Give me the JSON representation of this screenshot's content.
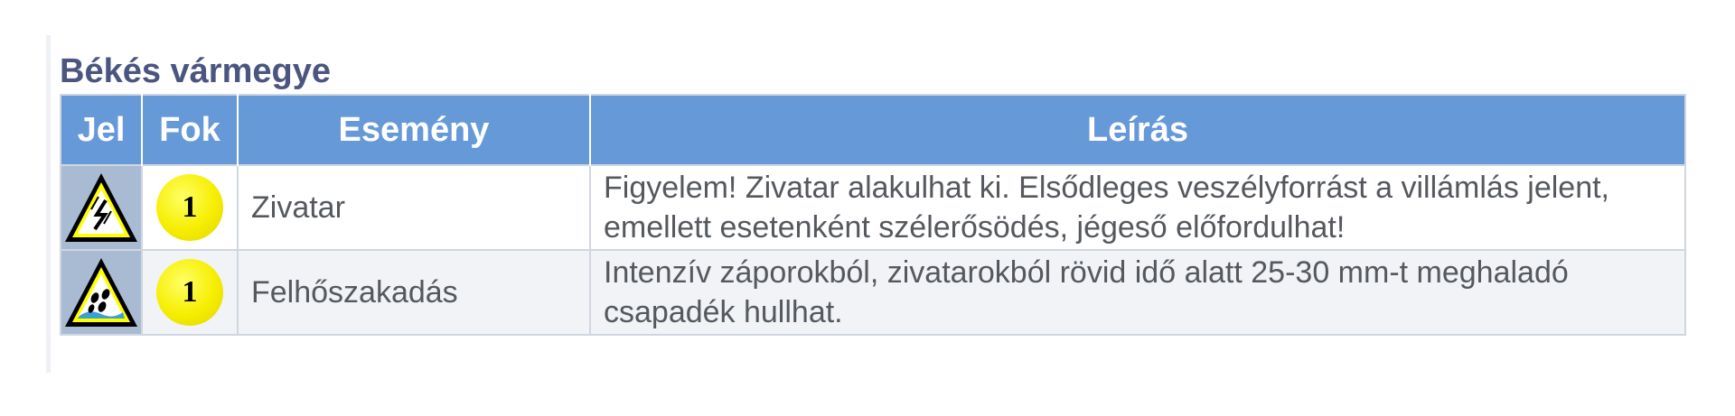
{
  "region": {
    "title": "Békés vármegye"
  },
  "table": {
    "headers": {
      "sign": "Jel",
      "level": "Fok",
      "event": "Esemény",
      "description": "Leírás"
    },
    "rows": [
      {
        "sign_icon": "thunderstorm-warning-icon",
        "level": "1",
        "event": "Zivatar",
        "description": "Figyelem! Zivatar alakulhat ki. Elsődleges veszélyforrást a villámlás jelent, emellett esetenként szélerősödés, jégeső előfordulhat!"
      },
      {
        "sign_icon": "cloudburst-warning-icon",
        "level": "1",
        "event": "Felhőszakadás",
        "description": "Intenzív záporokból, zivatarokból rövid idő alatt 25-30 mm-t meghaladó csapadék hullhat."
      }
    ]
  },
  "colors": {
    "header_bg": "#6699d8",
    "title_text": "#4a5580",
    "sign_cell_bg": "#a9bbd3",
    "level_badge": "#f6ee00"
  }
}
